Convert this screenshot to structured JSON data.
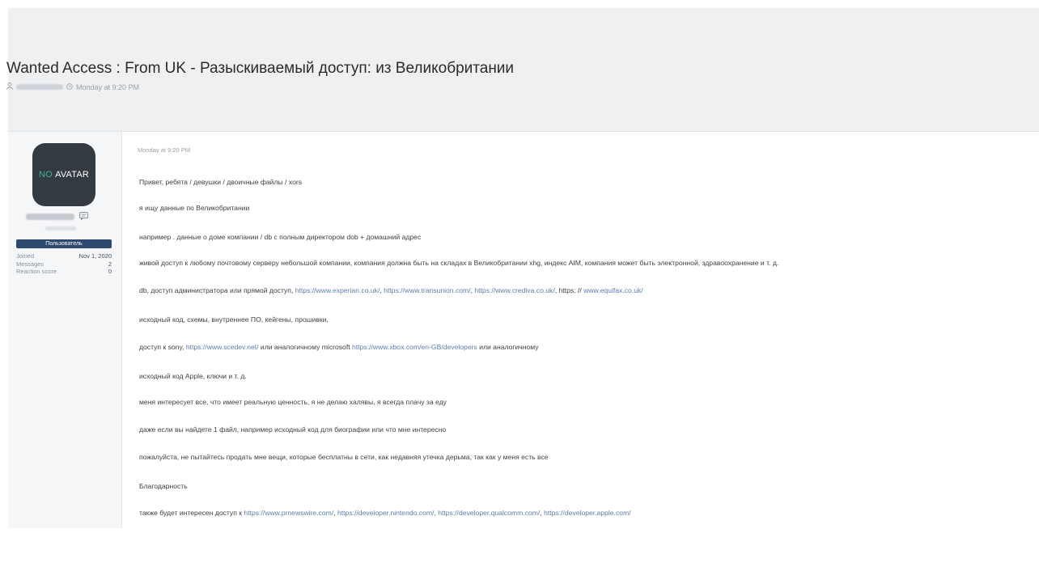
{
  "thread": {
    "title": "Wanted Access : From UK - Разыскиваемый доступ: из Великобритании",
    "meta_time": "Monday at 9:20 PM"
  },
  "author": {
    "avatar_no": "NO",
    "avatar_word": "AVATAR",
    "role": "Пользователь",
    "stats": [
      {
        "label": "Joined",
        "value": "Nov 1, 2020"
      },
      {
        "label": "Messages",
        "value": "2"
      },
      {
        "label": "Reaction score",
        "value": "0"
      }
    ]
  },
  "post": {
    "date": "Monday at 9:20 PM",
    "lines": {
      "l1": "Привет, ребята / девушки / двоичные файлы / xors",
      "l2": "я ищу данные по Великобритании",
      "l3": "например . данные о доме компании / db с полным директором dob + домашний адрес",
      "l4": "живой доступ к любому почтовому серверу небольшой компании, компания должна быть на складах в Великобритании xhg, индекс AIM, компания может быть электронной, здравоохранение и т. д.",
      "l5_a": "db, доступ администратора или прямой доступ, ",
      "l5_link1": "https://www.experian.co.uk/",
      "l5_sep1": ", ",
      "l5_link2": "https://www.transunion.com/",
      "l5_sep2": ", ",
      "l5_link3": "https://www.crediva.co.uk/",
      "l5_sep3": ", https: // ",
      "l5_link4": "www.equifax.co.uk/",
      "l6": "исходный код, схемы, внутреннее ПО, кейгены, прошивки,",
      "l7_a": "доступ к sony, ",
      "l7_link1": "https://www.scedev.net/",
      "l7_b": " или аналогичному microsoft ",
      "l7_link2": "https://www.xbox.com/en-GB/developers",
      "l7_c": " или аналогичному",
      "l8": "исходный код Apple, ключи и т. д.",
      "l9": "меня интересует все, что имеет реальную ценность, я не делаю халявы, я всегда плачу за еду",
      "l10": "даже если вы найдете 1 файл, например исходный код для биографии или что мне интересно",
      "l11": "пожалуйста, не пытайтесь продать мне вещи, которые бесплатны в сети, как недавняя утечка дерьма, так как у меня есть все",
      "l12": "Благодарность",
      "l13_a": "также будет интересен доступ к ",
      "l13_link1": "https://www.prnewswire.com/",
      "l13_sep1": ", ",
      "l13_link2": "https://developer.nintendo.com/",
      "l13_sep2": ", ",
      "l13_link3": "https://developer.qualcomm.com/",
      "l13_sep3": ", ",
      "l13_link4": "https://developer.apple.com/"
    }
  },
  "icons": {
    "user": "user-icon",
    "clock": "clock-icon",
    "message": "message-icon"
  }
}
